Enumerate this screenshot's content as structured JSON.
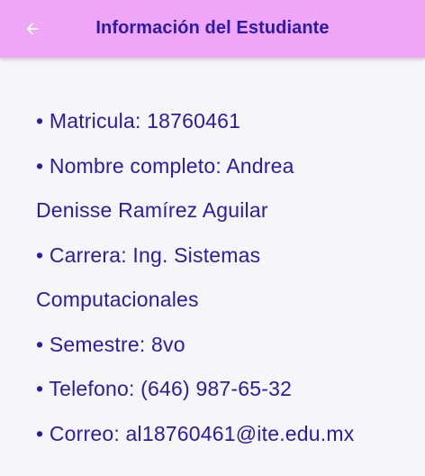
{
  "appbar": {
    "title": "Información del Estudiante",
    "back_icon": "arrow-left-icon",
    "color": "#f0a6f7",
    "title_color": "#2c1ba8"
  },
  "content": {
    "text_color": "#2c1ba8",
    "lines": [
      "• Matricula: 18760461",
      "• Nombre completo: Andrea",
      "Denisse Ramírez Aguilar",
      "• Carrera: Ing. Sistemas",
      "Computacionales",
      "• Semestre: 8vo",
      "• Telefono: (646) 987-65-32",
      "• Correo: al18760461@ite.edu.mx"
    ]
  }
}
